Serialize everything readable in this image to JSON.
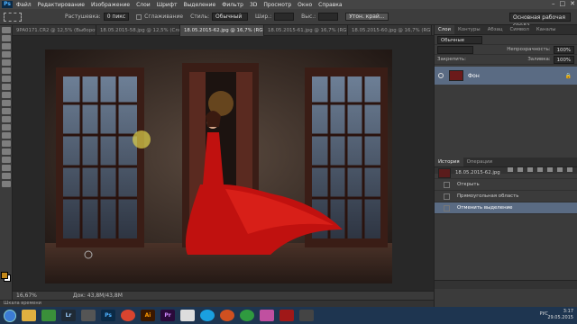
{
  "app": {
    "logo": "Ps"
  },
  "menu": [
    "Файл",
    "Редактирование",
    "Изображение",
    "Слои",
    "Шрифт",
    "Выделение",
    "Фильтр",
    "3D",
    "Просмотр",
    "Окно",
    "Справка"
  ],
  "options": {
    "feather_label": "Растушевка:",
    "feather_value": "0 пикс",
    "antialias": "Сглаживание",
    "style_label": "Стиль:",
    "style_value": "Обычный",
    "width_label": "Шир.:",
    "height_label": "Выс.:",
    "refine_button": "Утон. край...",
    "workspace": "Основная рабочая среда"
  },
  "tabs": [
    "9PA0171.CR2 @ 12,5% (Выборочная кор...",
    "18.05.2015-58.jpg @ 12,5% (Слой 0, RGB/...",
    "18.05.2015-62.jpg @ 16,7% (RGB/8)",
    "18.05.2015-61.jpg @ 16,7% (RGB/8...",
    "18.05.2015-60.jpg @ 16,7% (RGB/8..."
  ],
  "status": {
    "zoom": "16,67%",
    "doc": "Док: 43,8M/43,8M",
    "timeline": "Шкала времени"
  },
  "panels": {
    "layers_tabs": [
      "Слои",
      "Контуры",
      "Абзац",
      "Символ",
      "Каналы"
    ],
    "kind": "Обычные",
    "opacity_label": "Непрозрачность:",
    "opacity_value": "100%",
    "lock_label": "Закрепить:",
    "fill_label": "Заливка:",
    "fill_value": "100%",
    "layer_name": "Фон",
    "history_tabs": [
      "История",
      "Операции"
    ],
    "history_items": [
      "18.05.2015-62.jpg",
      "Открыть",
      "Прямоугольная область",
      "Отменить выделение"
    ]
  },
  "taskbar": {
    "apps": [
      "Lr",
      "Ps",
      "Ai",
      "Pr"
    ],
    "lang": "РУС",
    "time": "3:17",
    "date": "29.05.2015"
  },
  "colors": {
    "accent": "#5a6b83",
    "fg_swatch": "#c3881a",
    "dress": "#c0110f"
  }
}
